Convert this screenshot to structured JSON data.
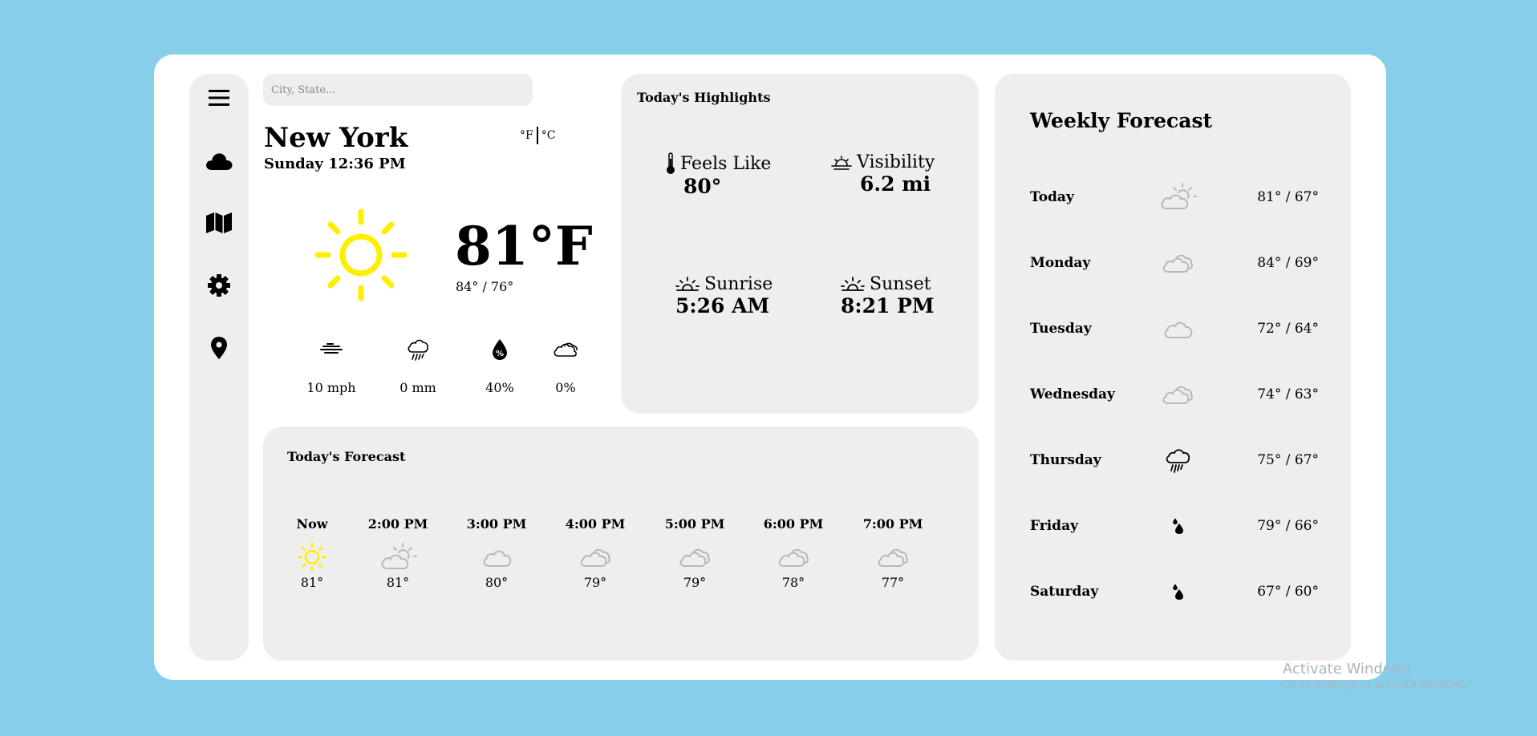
{
  "search": {
    "placeholder": "City, State..."
  },
  "location": {
    "city": "New York",
    "datetime": "Sunday 12:36 PM"
  },
  "units": {
    "fahrenheit": "°F",
    "celsius": "°C"
  },
  "current": {
    "temp": "81°F",
    "hilo": "84° / 76°",
    "condition_icon": "sun-icon",
    "wind": "10 mph",
    "precip": "0 mm",
    "humidity": "40%",
    "clouds": "0%"
  },
  "highlights": {
    "title": "Today's Highlights",
    "feels_like": {
      "label": "Feels Like",
      "value": "80°"
    },
    "visibility": {
      "label": "Visibility",
      "value": "6.2 mi"
    },
    "sunrise": {
      "label": "Sunrise",
      "value": "5:26 AM"
    },
    "sunset": {
      "label": "Sunset",
      "value": "8:21 PM"
    }
  },
  "today_forecast": {
    "title": "Today's Forecast",
    "hours": [
      {
        "time": "Now",
        "temp": "81°",
        "icon": "sun-icon"
      },
      {
        "time": "2:00 PM",
        "temp": "81°",
        "icon": "partly-sunny-icon"
      },
      {
        "time": "3:00 PM",
        "temp": "80°",
        "icon": "cloud-icon"
      },
      {
        "time": "4:00 PM",
        "temp": "79°",
        "icon": "clouds-icon"
      },
      {
        "time": "5:00 PM",
        "temp": "79°",
        "icon": "clouds-icon"
      },
      {
        "time": "6:00 PM",
        "temp": "78°",
        "icon": "clouds-icon"
      },
      {
        "time": "7:00 PM",
        "temp": "77°",
        "icon": "clouds-icon"
      }
    ]
  },
  "weekly": {
    "title": "Weekly Forecast",
    "days": [
      {
        "day": "Today",
        "temps": "81° / 67°",
        "icon": "partly-sunny-icon"
      },
      {
        "day": "Monday",
        "temps": "84° / 69°",
        "icon": "clouds-icon"
      },
      {
        "day": "Tuesday",
        "temps": "72° / 64°",
        "icon": "cloud-icon"
      },
      {
        "day": "Wednesday",
        "temps": "74° / 63°",
        "icon": "clouds-icon"
      },
      {
        "day": "Thursday",
        "temps": "75° / 67°",
        "icon": "rain-icon"
      },
      {
        "day": "Friday",
        "temps": "79° / 66°",
        "icon": "drizzle-icon"
      },
      {
        "day": "Saturday",
        "temps": "67° / 60°",
        "icon": "drizzle-icon"
      }
    ]
  },
  "watermark": {
    "line1": "Activate Windows",
    "line2": "Go to Settings to activate Windows."
  },
  "colors": {
    "background": "#87ceeb",
    "card": "#ffffff",
    "panel": "#eeeeee",
    "sun": "#ffee00",
    "cloud_gray": "#b8b8b8"
  }
}
